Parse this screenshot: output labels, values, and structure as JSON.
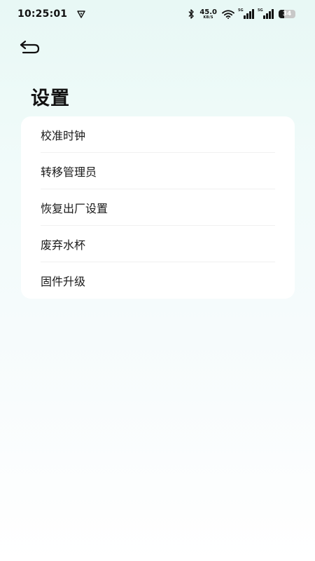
{
  "status_bar": {
    "time": "10:25:01",
    "net_speed": "45.0",
    "net_unit": "KB/S",
    "signal1_tag": "5G",
    "signal2_tag": "5G",
    "battery_percent": "34",
    "battery_level": 0.34
  },
  "header": {
    "back_icon": "back-arrow-icon"
  },
  "page": {
    "title": "设置"
  },
  "settings": {
    "items": [
      {
        "label": "校准时钟"
      },
      {
        "label": "转移管理员"
      },
      {
        "label": "恢复出厂设置"
      },
      {
        "label": "废弃水杯"
      },
      {
        "label": "固件升级"
      }
    ]
  }
}
